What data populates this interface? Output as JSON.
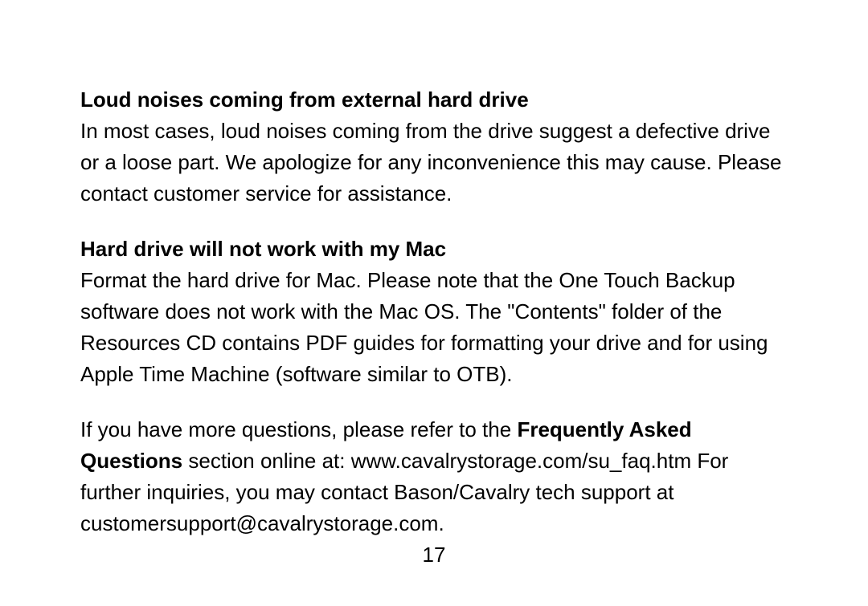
{
  "sections": [
    {
      "heading": "Loud noises coming from external hard drive",
      "body": "In most cases, loud noises coming from the drive suggest a defective drive or a loose part. We apologize for any inconvenience this may cause. Please contact customer service for assistance."
    },
    {
      "heading": "Hard drive will not work with my Mac",
      "body": "Format the hard drive for Mac. Please note that the One Touch Backup software does not work with the Mac OS. The \"Contents\" folder of the Resources CD contains PDF guides for formatting your drive and for using Apple Time Machine (software similar to OTB)."
    }
  ],
  "footer": {
    "pre_bold": "If you have more questions, please refer to the ",
    "bold": "Frequently Asked Questions",
    "post_bold": " section online at: www.cavalrystorage.com/su_faq.htm  For further inquiries, you may contact Bason/Cavalry tech support at customersupport@cavalrystorage.com."
  },
  "page_number": "17"
}
